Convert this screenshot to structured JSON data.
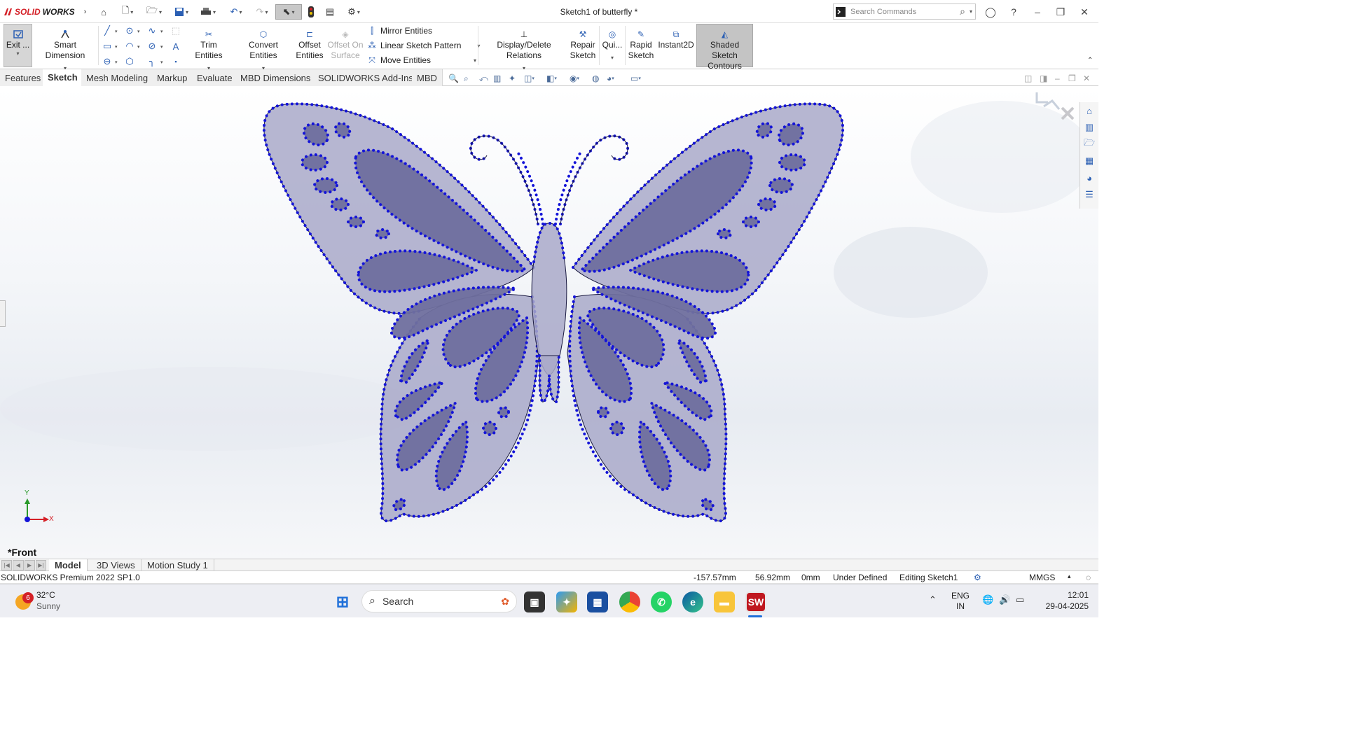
{
  "app": {
    "name_a": "SOLID",
    "name_b": "WORKS",
    "document_title": "Sketch1 of butterfly *"
  },
  "search": {
    "placeholder": "Search Commands"
  },
  "ribbon": {
    "exit_label": "Exit ...",
    "smart_dimension": "Smart Dimension",
    "trim_entities": "Trim Entities",
    "convert_entities": "Convert Entities",
    "offset_entities_1": "Offset",
    "offset_entities_2": "Entities",
    "offset_on_surface_1": "Offset On",
    "offset_on_surface_2": "Surface",
    "mirror_entities": "Mirror Entities",
    "linear_sketch_pattern": "Linear Sketch Pattern",
    "move_entities": "Move Entities",
    "display_delete_relations": "Display/Delete Relations",
    "repair_sketch_1": "Repair",
    "repair_sketch_2": "Sketch",
    "quick_snaps": "Qui...",
    "rapid_sketch_1": "Rapid",
    "rapid_sketch_2": "Sketch",
    "instant2d": "Instant2D",
    "shaded_contours_1": "Shaded Sketch",
    "shaded_contours_2": "Contours"
  },
  "tabs": [
    "Features",
    "Sketch",
    "Mesh Modeling",
    "Markup",
    "Evaluate",
    "MBD Dimensions",
    "SOLIDWORKS Add-Ins",
    "MBD"
  ],
  "viewport": {
    "view_label": "*Front",
    "axis_x": "X",
    "axis_y": "Y"
  },
  "bottom_tabs": [
    "Model",
    "3D Views",
    "Motion Study 1"
  ],
  "status": {
    "product": "SOLIDWORKS Premium 2022 SP1.0",
    "x": "-157.57mm",
    "y": "56.92mm",
    "z": "0mm",
    "definition": "Under Defined",
    "editing": "Editing Sketch1",
    "units": "MMGS"
  },
  "taskbar": {
    "temp": "32°C",
    "weather": "Sunny",
    "badge": "6",
    "search": "Search",
    "lang_1": "ENG",
    "lang_2": "IN",
    "time": "12:01",
    "date": "29-04-2025"
  },
  "colors": {
    "sketch_blue": "#1414d8",
    "wing_fill": "#a9a9c9",
    "spot_fill": "#7070a0"
  }
}
